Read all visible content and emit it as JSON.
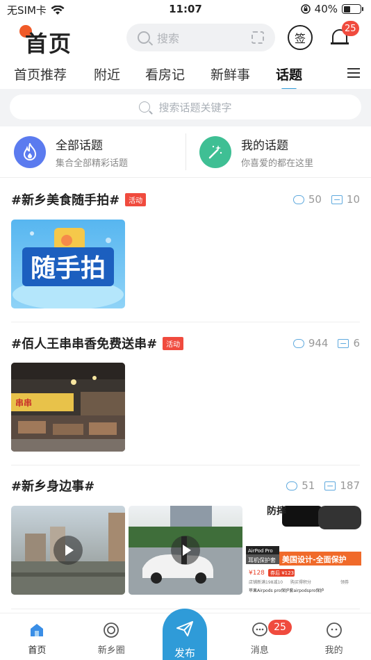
{
  "status_bar": {
    "carrier": "无SIM卡",
    "time": "11:07",
    "battery": "40%"
  },
  "header": {
    "title": "首页",
    "search_placeholder": "搜索",
    "sign_label": "签",
    "notification_count": "25"
  },
  "tabs": [
    {
      "label": "首页推荐"
    },
    {
      "label": "附近"
    },
    {
      "label": "看房记"
    },
    {
      "label": "新鲜事"
    },
    {
      "label": "话题",
      "active": true
    }
  ],
  "topic_search": {
    "placeholder": "搜索话题关键字"
  },
  "categories": [
    {
      "title": "全部话题",
      "subtitle": "集合全部精彩话题",
      "icon": "flame-icon",
      "color": "#5b7bef"
    },
    {
      "title": "我的话题",
      "subtitle": "你喜爱的都在这里",
      "icon": "magic-wand-icon",
      "color": "#3fbf94"
    }
  ],
  "topics": [
    {
      "title": "#新乡美食随手拍#",
      "tag": "活动",
      "comments": "50",
      "images": "10",
      "thumb_text": "随手拍"
    },
    {
      "title": "#佰人王串串香免费送串#",
      "tag": "活动",
      "comments": "944",
      "images": "6",
      "thumb_text": "串串"
    },
    {
      "title": "#新乡身边事#",
      "tag": "",
      "comments": "51",
      "images": "187",
      "ad_texts": {
        "head": "防摔",
        "brand": "AirPod Pro",
        "product": "耳机保护套",
        "slogan": "美国设计-全面保护",
        "price": "¥128",
        "coupon": "券后 ¥123",
        "line1": "店铺新满198减10",
        "line2": "购买得积分",
        "line3": "领券",
        "footer": "苹果Airpods pro保护套airpodspro保护"
      }
    }
  ],
  "bottom_nav": [
    {
      "label": "首页",
      "active": true
    },
    {
      "label": "新乡圈"
    },
    {
      "label": "发布"
    },
    {
      "label": "消息",
      "badge": "25"
    },
    {
      "label": "我的"
    }
  ]
}
